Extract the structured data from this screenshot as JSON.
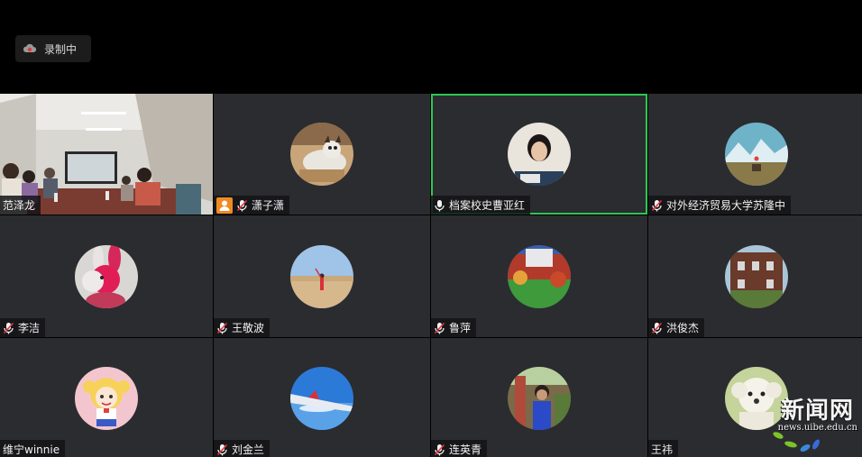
{
  "recording": {
    "label": "录制中"
  },
  "participants": [
    {
      "name": "范泽龙",
      "muted": false,
      "video": true
    },
    {
      "name": "潇子潇",
      "muted": true,
      "host": true,
      "avatar_icon": "cat-photo-avatar"
    },
    {
      "name": "档案校史曹亚红",
      "muted": false,
      "active": true,
      "avatar_icon": "woman-portrait-avatar"
    },
    {
      "name": "对外经济贸易大学苏隆中",
      "muted": true,
      "avatar_icon": "mountain-landscape-avatar"
    },
    {
      "name": "李洁",
      "muted": true,
      "avatar_icon": "pink-rabbit-toy-avatar"
    },
    {
      "name": "王敬波",
      "muted": true,
      "avatar_icon": "desert-person-avatar"
    },
    {
      "name": "鲁萍",
      "muted": true,
      "avatar_icon": "garden-house-avatar"
    },
    {
      "name": "洪俊杰",
      "muted": true,
      "avatar_icon": "ivy-building-avatar"
    },
    {
      "name": "维宁winnie",
      "muted": false,
      "avatar_icon": "cartoon-girl-avatar"
    },
    {
      "name": "刘金兰",
      "muted": true,
      "avatar_icon": "airplane-wing-avatar"
    },
    {
      "name": "连英青",
      "muted": true,
      "avatar_icon": "woman-outdoor-avatar"
    },
    {
      "name": "王祎",
      "muted": false,
      "avatar_icon": "white-dog-avatar"
    }
  ],
  "watermark": {
    "title": "新闻网",
    "url": "news.uibe.edu.cn"
  },
  "colors": {
    "active_border": "#2dc653",
    "tile_bg": "#2b2c2f",
    "mute_red": "#e0383e",
    "host_orange": "#f08a24"
  }
}
